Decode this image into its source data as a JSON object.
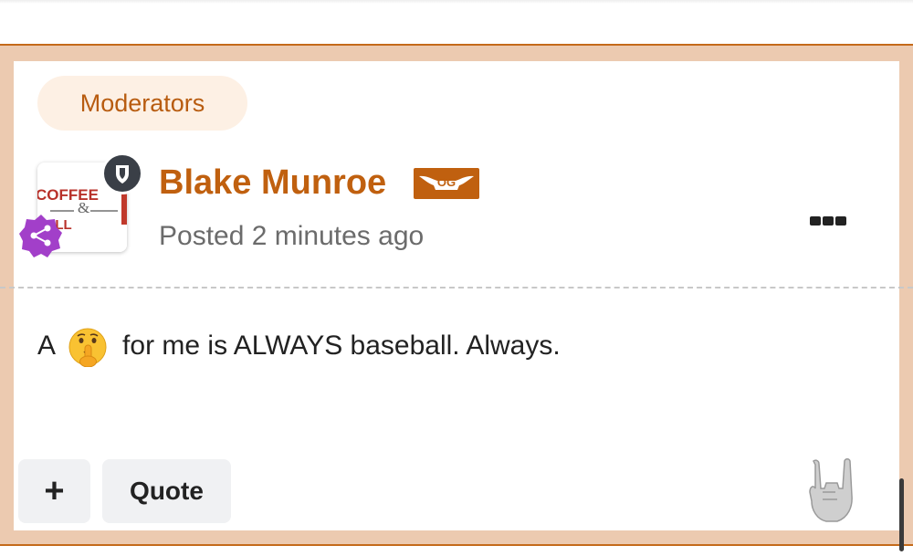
{
  "post": {
    "group_label": "Moderators",
    "author_name": "Blake Munroe",
    "author_badge": "OG",
    "posted_time": "Posted 2 minutes ago",
    "body_before_emoji": "A",
    "body_emoji": "shushing-face-emoji",
    "body_after_emoji": "for me is ALWAYS baseball. Always.",
    "avatar_logo_text": [
      "COFFEE",
      "&",
      "FOOTBALL"
    ]
  },
  "actions": {
    "plus_label": "+",
    "quote_label": "Quote",
    "reaction_icon": "horns-hand-icon",
    "more_icon": "more-options-icon"
  },
  "colors": {
    "accent": "#c0600f",
    "frame": "#eccab0",
    "pill_bg": "#fdf0e4",
    "moderator_badge": "#3a3f47",
    "share_badge": "#a23fc9"
  }
}
